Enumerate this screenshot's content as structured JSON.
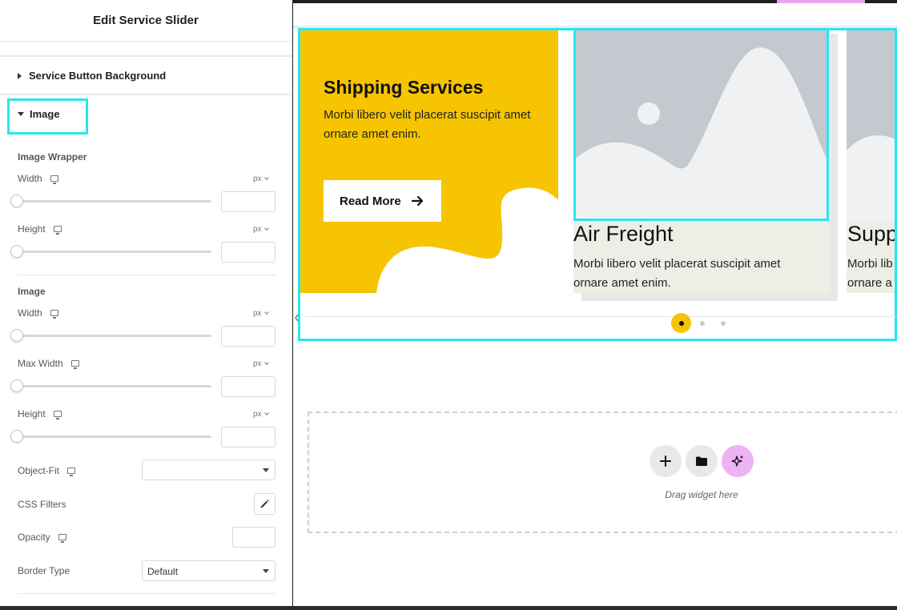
{
  "panel": {
    "title": "Edit Service Slider",
    "sections": {
      "service_button_background": "Service Button Background",
      "image": "Image"
    },
    "image_wrapper": {
      "label": "Image Wrapper",
      "width_label": "Width",
      "height_label": "Height",
      "unit": "px"
    },
    "image": {
      "label": "Image",
      "width_label": "Width",
      "max_width_label": "Max Width",
      "height_label": "Height",
      "unit": "px",
      "object_fit_label": "Object-Fit",
      "object_fit_value": "",
      "css_filters_label": "CSS Filters",
      "opacity_label": "Opacity",
      "border_type_label": "Border Type",
      "border_type_value": "Default"
    }
  },
  "canvas": {
    "cards": [
      {
        "title": "Shipping Services",
        "description": "Morbi libero velit placerat suscipit amet ornare amet enim.",
        "button_label": "Read More"
      },
      {
        "title": "Air Freight",
        "description": "Morbi libero velit placerat suscipit amet ornare amet enim."
      },
      {
        "title": "Supp",
        "description_line1": "Morbi lib",
        "description_line2": "ornare a"
      }
    ],
    "pagination": {
      "count": 3,
      "active": 1
    },
    "drop_zone": {
      "text": "Drag widget here"
    }
  },
  "colors": {
    "accent_yellow": "#f6c400",
    "selection_cyan": "#27e6f0",
    "ai_pink": "#eeb3f4",
    "card_bg": "#eeeee6",
    "placeholder_gray": "#c3c9cf"
  },
  "icons": [
    "caret-right-icon",
    "caret-down-icon",
    "monitor-icon",
    "chevron-down-icon",
    "pencil-icon",
    "arrow-right-icon",
    "plus-icon",
    "folder-icon",
    "sparkle-icon",
    "image-placeholder-icon"
  ]
}
